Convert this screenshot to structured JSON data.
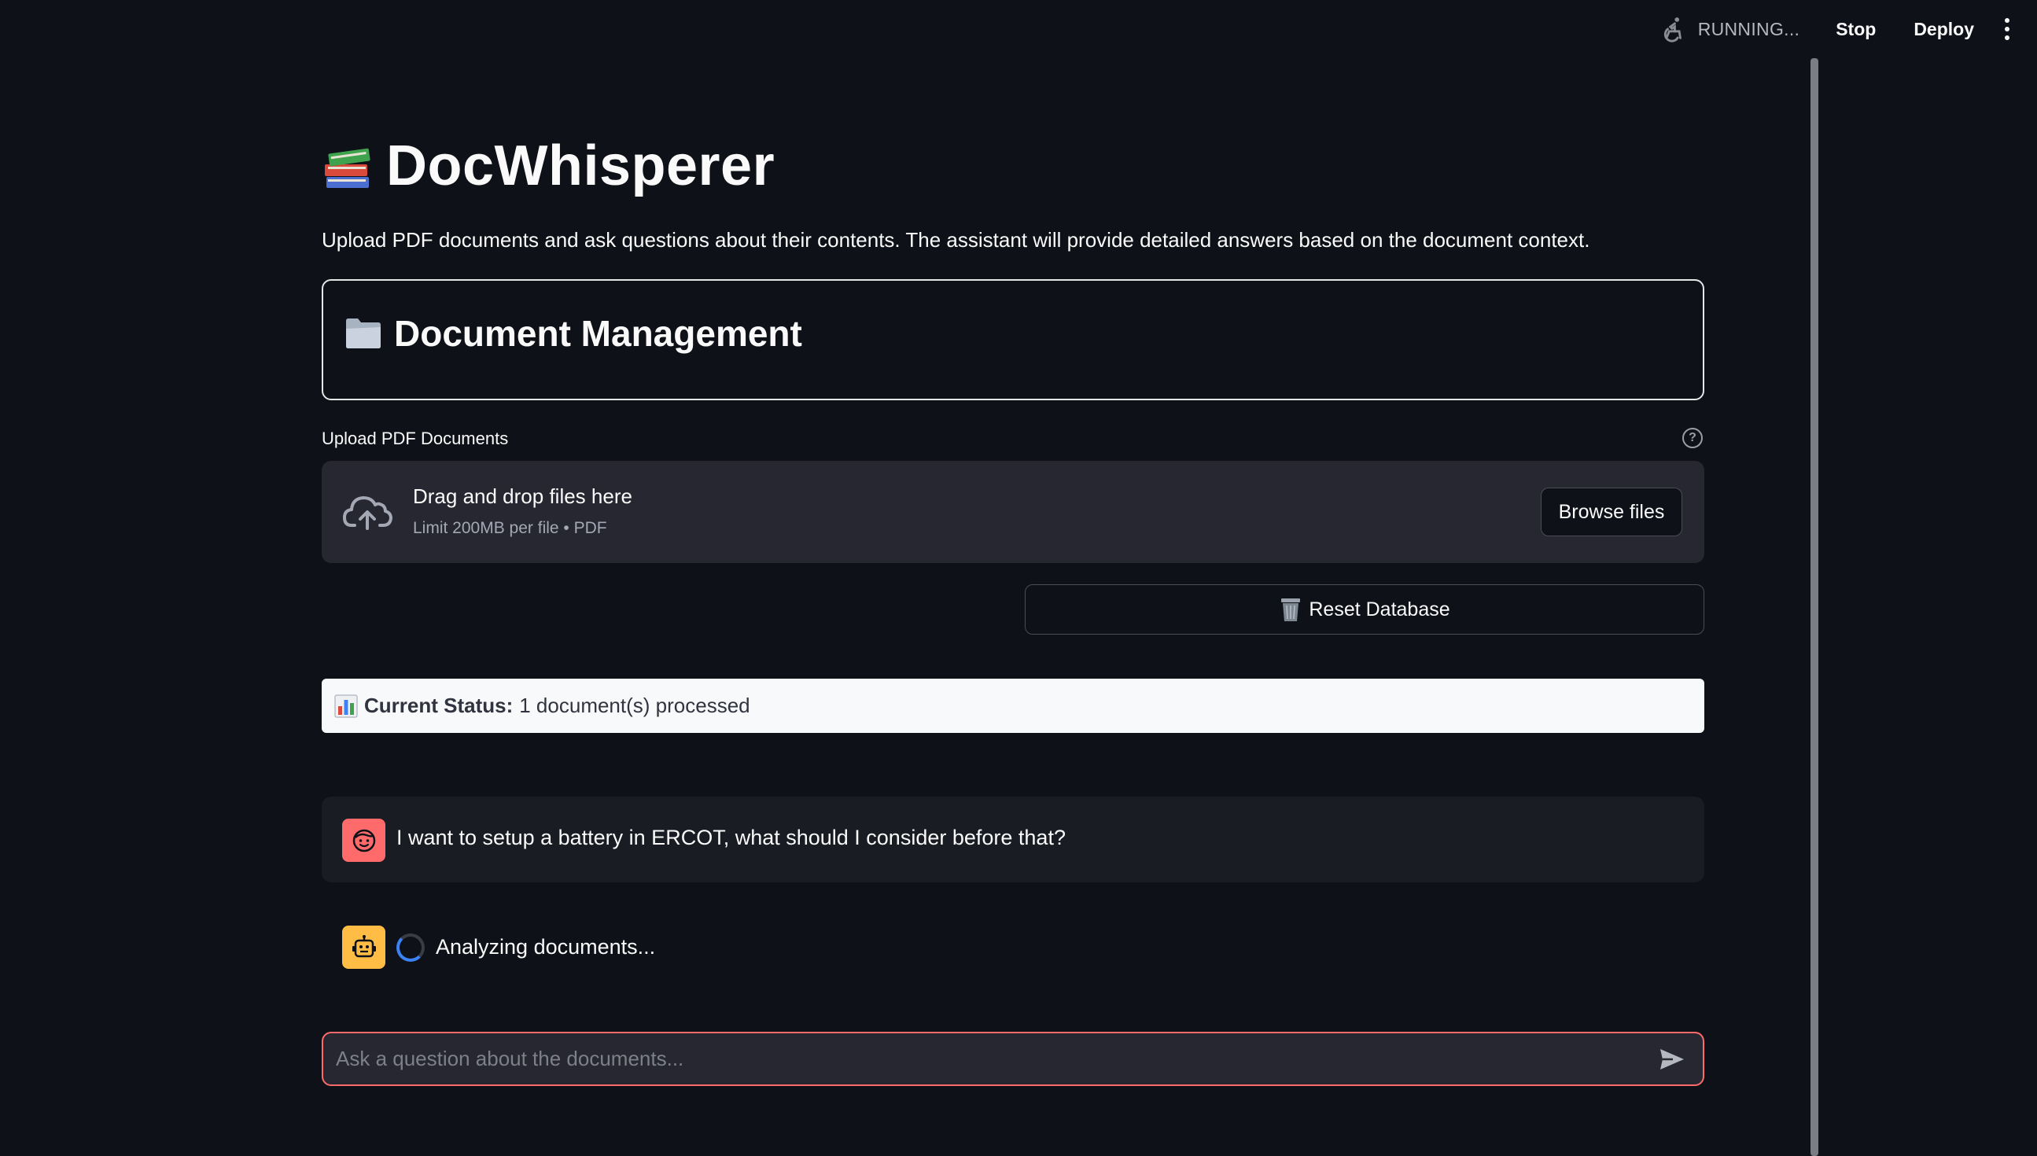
{
  "header": {
    "status_text": "RUNNING...",
    "stop_label": "Stop",
    "deploy_label": "Deploy"
  },
  "page": {
    "title": "DocWhisperer",
    "subtitle": "Upload PDF documents and ask questions about their contents. The assistant will provide detailed answers based on the document context."
  },
  "document_management": {
    "heading": "Document Management",
    "upload_label": "Upload PDF Documents",
    "dropzone_title": "Drag and drop files here",
    "dropzone_limit": "Limit 200MB per file • PDF",
    "browse_label": "Browse files",
    "reset_label": "Reset Database"
  },
  "status": {
    "label": "Current Status:",
    "value": "1 document(s) processed"
  },
  "chat": {
    "messages": [
      {
        "role": "user",
        "text": "I want to setup a battery in ERCOT, what should I consider before that?"
      },
      {
        "role": "assistant",
        "text": "Analyzing documents..."
      }
    ],
    "input_placeholder": "Ask a question about the documents..."
  },
  "icons": {
    "running": "accessibility-icon",
    "title": "books-icon",
    "heading": "folder-icon",
    "upload": "cloud-upload-icon",
    "help": "question-circle-icon",
    "reset": "trash-icon",
    "status": "bar-chart-icon",
    "user_avatar": "face-icon",
    "assistant_avatar": "robot-icon",
    "send": "send-icon"
  },
  "colors": {
    "background": "#0e1117",
    "user_avatar": "#ff6b6b",
    "assistant_avatar": "#ffbd45",
    "input_border": "#ff6b6b",
    "spinner": "#3b82f6"
  }
}
